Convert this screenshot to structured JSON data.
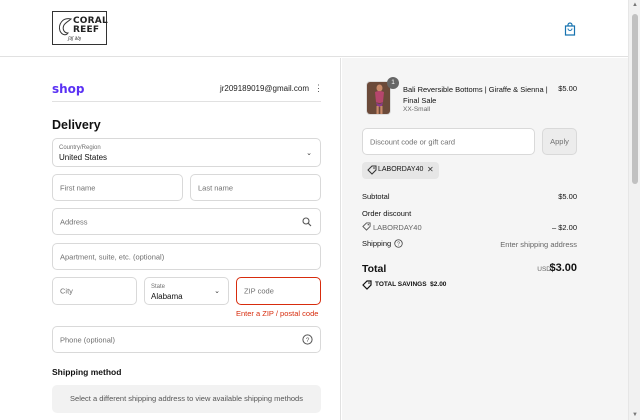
{
  "header": {
    "logo_line1": "CORAL",
    "logo_line2": "REEF",
    "logo_signature": "ʃ∂ʃ ∂∂ȷ"
  },
  "account": {
    "shop_label": "shop",
    "email": "jr209189019@gmail.com"
  },
  "delivery": {
    "heading": "Delivery",
    "country_label": "Country/Region",
    "country_value": "United States",
    "first_name_ph": "First name",
    "last_name_ph": "Last name",
    "address_ph": "Address",
    "apartment_ph": "Apartment, suite, etc. (optional)",
    "city_ph": "City",
    "state_label": "State",
    "state_value": "Alabama",
    "zip_ph": "ZIP code",
    "zip_error": "Enter a ZIP / postal code",
    "phone_ph": "Phone (optional)"
  },
  "shipping": {
    "heading": "Shipping method",
    "notice": "Select a different shipping address to view available shipping methods"
  },
  "order": {
    "quantity": "1",
    "product_name": "Bali Reversible Bottoms | Giraffe & Sienna | Final Sale",
    "variant": "XX-Small",
    "price": "$5.00",
    "discount_ph": "Discount code or gift card",
    "apply_label": "Apply",
    "code_chip": "LABORDAY40",
    "subtotal_label": "Subtotal",
    "subtotal_value": "$5.00",
    "order_discount_label": "Order discount",
    "discount_code": "LABORDAY40",
    "discount_value": "– $2.00",
    "shipping_label": "Shipping",
    "shipping_value": "Enter shipping address",
    "total_label": "Total",
    "currency": "USD",
    "total_value": "$3.00",
    "savings_label": "TOTAL SAVINGS",
    "savings_value": "$2.00"
  },
  "colors": {
    "shop_brand": "#5a31f4",
    "error": "#d72c0d",
    "summary_bg": "#f5f5f5"
  }
}
